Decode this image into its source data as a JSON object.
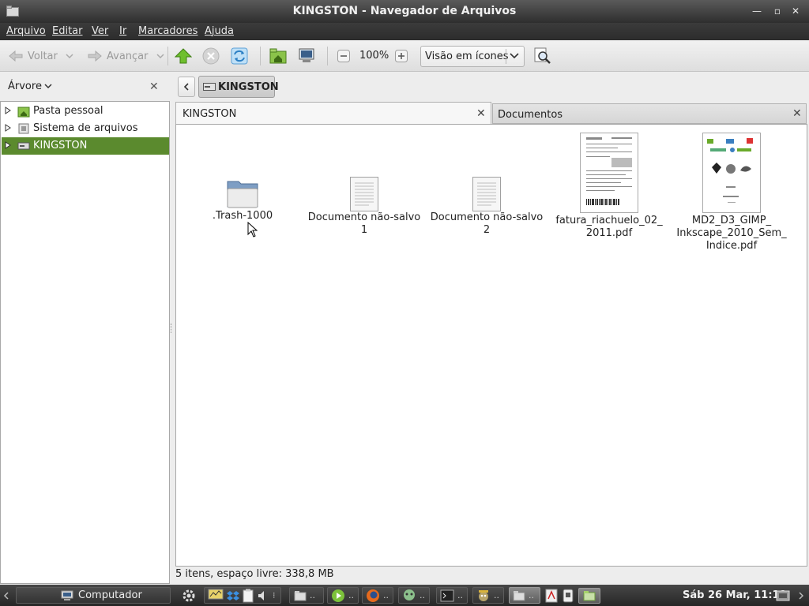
{
  "window": {
    "title": "KINGSTON - Navegador de Arquivos",
    "controls": [
      "minimize-icon",
      "maximize-icon",
      "close-icon"
    ]
  },
  "menu": [
    "Arquivo",
    "Editar",
    "Ver",
    "Ir",
    "Marcadores",
    "Ajuda"
  ],
  "toolbar": {
    "back_label": "Voltar",
    "forward_label": "Avançar",
    "zoom": "100%",
    "view_mode": "Visão em ícones"
  },
  "sidebar": {
    "mode": "Árvore",
    "items": [
      {
        "label": "Pasta pessoal",
        "icon": "home-folder-icon",
        "selected": false
      },
      {
        "label": "Sistema de arquivos",
        "icon": "filesystem-icon",
        "selected": false
      },
      {
        "label": "KINGSTON",
        "icon": "drive-icon",
        "selected": true
      }
    ]
  },
  "location": {
    "crumb": "KINGSTON"
  },
  "tabs": [
    {
      "label": "KINGSTON",
      "active": true
    },
    {
      "label": "Documentos",
      "active": false
    }
  ],
  "files": [
    {
      "name": ".Trash-1000",
      "type": "folder"
    },
    {
      "name": "Documento não-salvo 1",
      "type": "text"
    },
    {
      "name": "Documento não-salvo 2",
      "type": "text"
    },
    {
      "name_lines": [
        "fatura_riachuelo_02_",
        "2011.pdf"
      ],
      "type": "pdf"
    },
    {
      "name_lines": [
        "MD2_D3_GIMP_",
        "Inkscape_2010_Sem_",
        "Indice.pdf"
      ],
      "type": "pdf"
    }
  ],
  "status": "5 itens, espaço livre: 338,8 MB",
  "panel": {
    "computer_label": "Computador",
    "clock": "Sáb 26 Mar, 11:11",
    "dots": ".."
  },
  "colors": {
    "selection": "#5b8a2e",
    "titlebar": "#3a3a3a",
    "accent_green": "#6aaa2a"
  }
}
